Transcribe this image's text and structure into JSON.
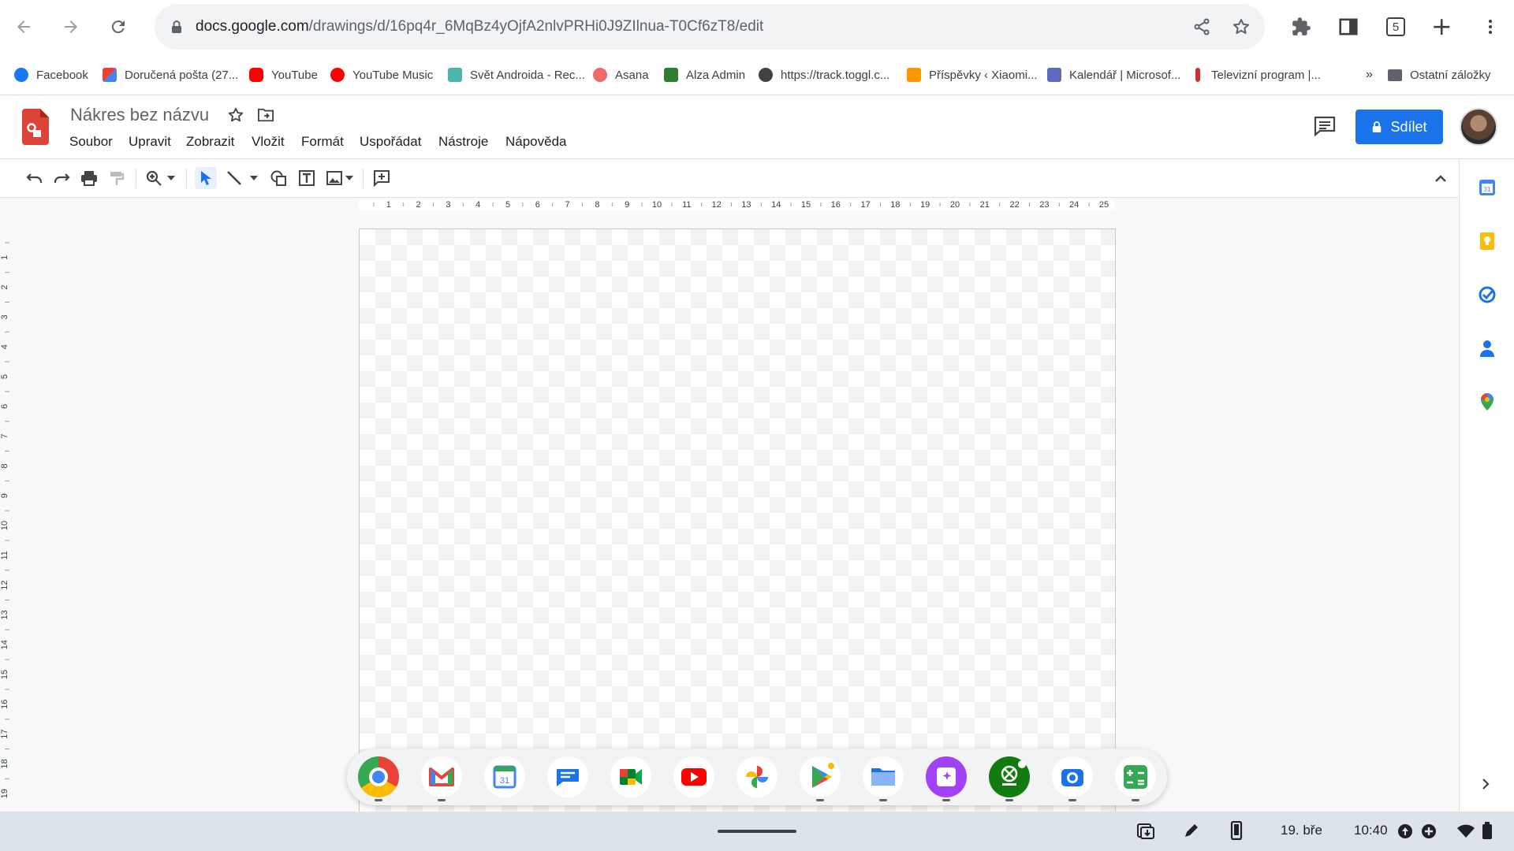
{
  "browser": {
    "url_domain": "docs.google.com",
    "url_path": "/drawings/d/16pq4r_6MqBz4yOjfA2nlvPRHi0J9ZIlnua-T0Cf6zT8/edit",
    "tab_count": "5",
    "bookmarks": [
      {
        "label": "Facebook",
        "color": "#1877f2"
      },
      {
        "label": "Doručená pošta (27...",
        "color": "#ea4335"
      },
      {
        "label": "YouTube",
        "color": "#ff0000"
      },
      {
        "label": "YouTube Music",
        "color": "#ff0000"
      },
      {
        "label": "Svět Androida - Rec...",
        "color": "#4db6ac"
      },
      {
        "label": "Asana",
        "color": "#f06a6a"
      },
      {
        "label": "Alza Admin",
        "color": "#2e7d32"
      },
      {
        "label": "https://track.toggl.c...",
        "color": "#424242"
      },
      {
        "label": "Příspěvky ‹ Xiaomi...",
        "color": "#ff9800"
      },
      {
        "label": "Kalendář | Microsof...",
        "color": "#5c6bc0"
      },
      {
        "label": "Televizní program |...",
        "color": "#d32f2f"
      }
    ],
    "overflow_label": "»",
    "other_bookmarks": "Ostatní záložky"
  },
  "docs": {
    "title": "Nákres bez názvu",
    "menu": [
      "Soubor",
      "Upravit",
      "Zobrazit",
      "Vložit",
      "Formát",
      "Uspořádat",
      "Nástroje",
      "Nápověda"
    ],
    "share_label": "Sdílet"
  },
  "rulers": {
    "top": [
      "1",
      "2",
      "3",
      "4",
      "5",
      "6",
      "7",
      "8",
      "9",
      "10",
      "11",
      "12",
      "13",
      "14",
      "15",
      "16",
      "17",
      "18",
      "19",
      "20",
      "21",
      "22",
      "23",
      "24",
      "25"
    ],
    "left": [
      "1",
      "2",
      "3",
      "4",
      "5",
      "6",
      "7",
      "8",
      "9",
      "10",
      "11",
      "12",
      "13",
      "14",
      "15",
      "16",
      "17",
      "18",
      "19"
    ]
  },
  "system": {
    "date": "19. bře",
    "time": "10:40"
  },
  "colors": {
    "accent": "#1a73e8",
    "shelf": "#dde3ea"
  }
}
